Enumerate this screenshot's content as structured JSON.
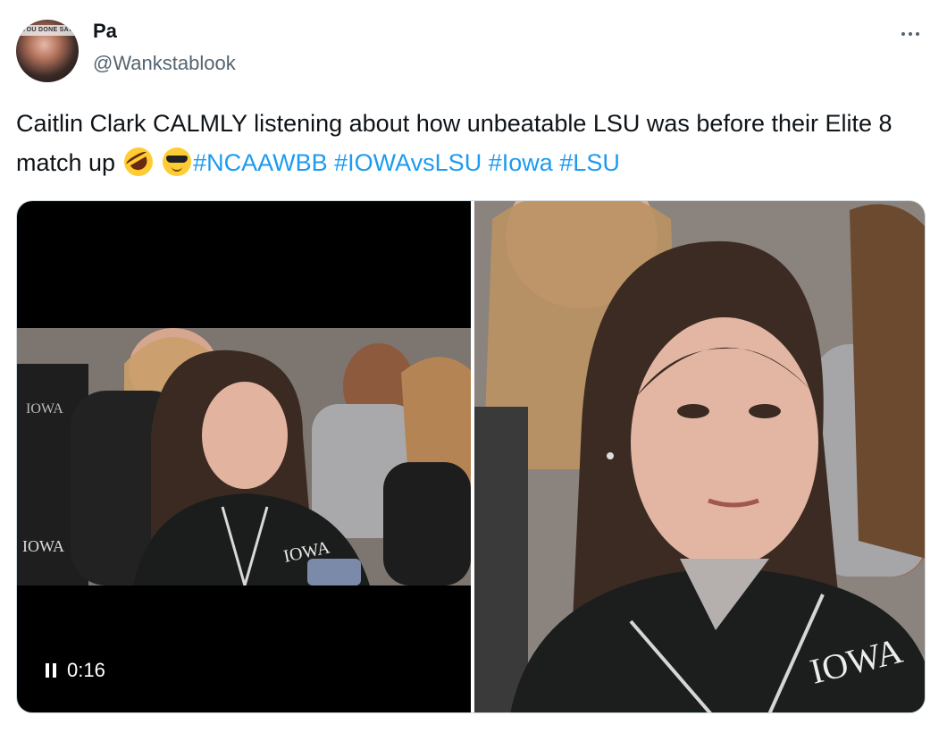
{
  "author": {
    "display_name": "Pa",
    "handle": "@Wankstablook",
    "avatar_text": "YOU DONE SAY"
  },
  "more_icon": "more-horizontal-icon",
  "tweet": {
    "text_before_emoji": "Caitlin Clark CALMLY listening about how unbeatable LSU was before their Elite 8 match up",
    "emojis": [
      "rolling-on-floor-laughing-emoji",
      "smiling-face-with-sunglasses-emoji"
    ],
    "hashtags": [
      "#NCAAWBB",
      "#IOWAvsLSU",
      "#Iowa",
      "#LSU"
    ]
  },
  "video": {
    "timestamp": "0:16",
    "control_icon": "pause-icon"
  },
  "colors": {
    "link": "#1d9bf0",
    "text": "#0f1419",
    "secondary": "#536471",
    "border": "#cfd9de"
  }
}
